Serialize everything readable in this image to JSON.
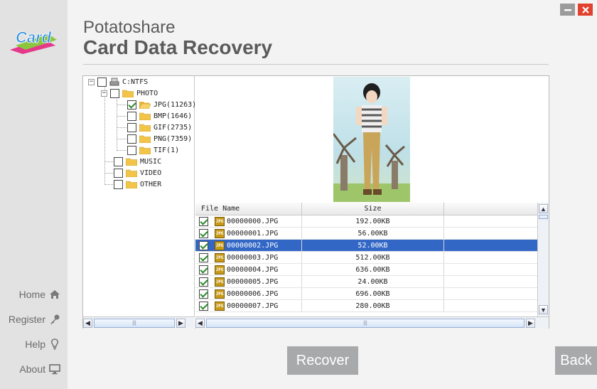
{
  "app": {
    "brand": "Potatoshare",
    "product": "Card Data Recovery",
    "logo_text": "Card"
  },
  "sidebar": {
    "items": [
      {
        "label": "Home",
        "icon": "home-icon"
      },
      {
        "label": "Register",
        "icon": "key-icon"
      },
      {
        "label": "Help",
        "icon": "lightbulb-icon"
      },
      {
        "label": "About",
        "icon": "monitor-icon"
      }
    ]
  },
  "tree": {
    "drive": "C:NTFS",
    "photo": "PHOTO",
    "jpg": "JPG(11263)",
    "bmp": "BMP(1646)",
    "gif": "GIF(2735)",
    "png": "PNG(7359)",
    "tif": "TIF(1)",
    "music": "MUSIC",
    "video": "VIDEO",
    "other": "OTHER"
  },
  "filelist": {
    "col_name": "File Name",
    "col_size": "Size",
    "file_icon_text": "JPG",
    "rows": [
      {
        "name": "00000000.JPG",
        "size": "192.00KB",
        "checked": true
      },
      {
        "name": "00000001.JPG",
        "size": "56.00KB",
        "checked": true
      },
      {
        "name": "00000002.JPG",
        "size": "52.00KB",
        "checked": true,
        "selected": true
      },
      {
        "name": "00000003.JPG",
        "size": "512.00KB",
        "checked": true
      },
      {
        "name": "00000004.JPG",
        "size": "636.00KB",
        "checked": true
      },
      {
        "name": "00000005.JPG",
        "size": "24.00KB",
        "checked": true
      },
      {
        "name": "00000006.JPG",
        "size": "696.00KB",
        "checked": true
      },
      {
        "name": "00000007.JPG",
        "size": "280.00KB",
        "checked": true
      }
    ]
  },
  "buttons": {
    "recover": "Recover",
    "back": "Back"
  },
  "colors": {
    "selection": "#3367c6",
    "button": "#a7a9ab",
    "close": "#e1412e"
  }
}
